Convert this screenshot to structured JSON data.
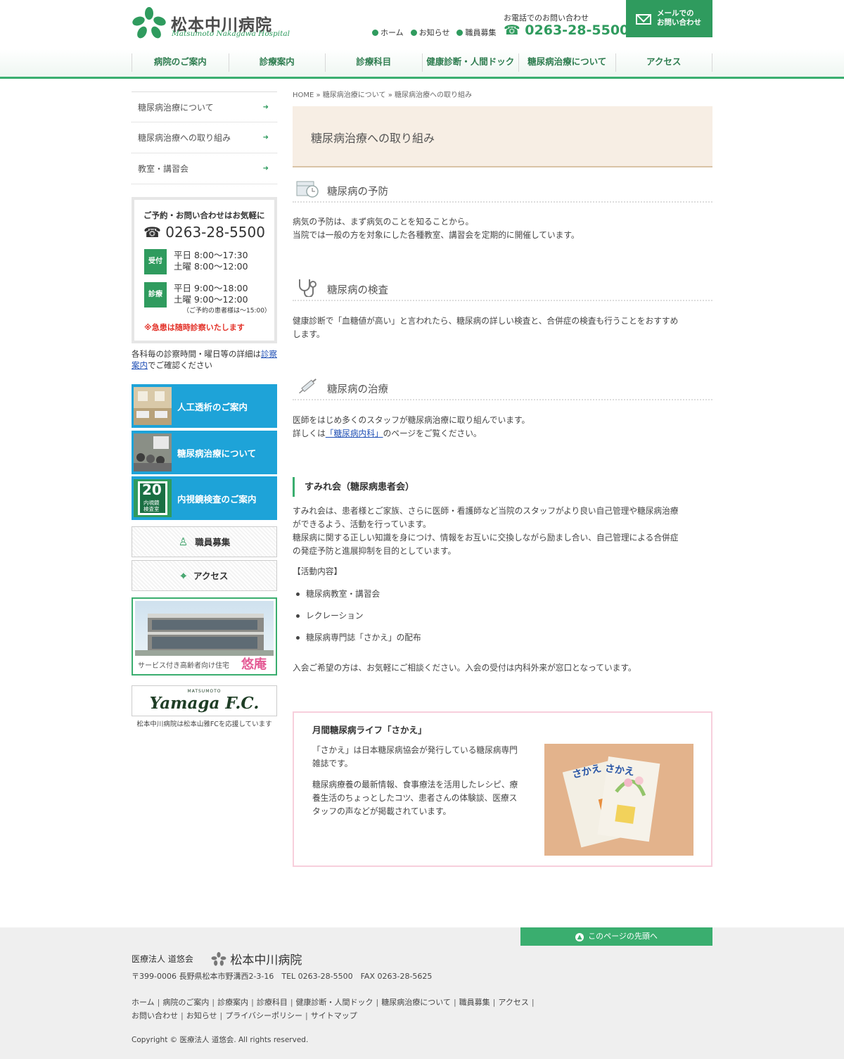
{
  "header": {
    "logo_name": "松本中川病院",
    "logo_en": "Matsumoto Nakagawa Hospital",
    "toplinks": [
      "ホーム",
      "お知らせ",
      "職員募集"
    ],
    "tel_label": "お電話でのお問い合わせ",
    "tel": "0263-28-5500",
    "mail_btn": [
      "メールでの",
      "お問い合わせ"
    ],
    "nav": [
      "病院のご案内",
      "診療案内",
      "診療科目",
      "健康診断・人間ドック",
      "糖尿病治療について",
      "アクセス"
    ]
  },
  "sidebar": {
    "subnav": [
      "糖尿病治療について",
      "糖尿病治療への取り組み",
      "教室・講習会"
    ],
    "info": {
      "heading": "ご予約・お問い合わせはお気軽に",
      "tel": "0263-28-5500",
      "reception_tag": "受付",
      "reception_lines": [
        "平日 8:00～17:30",
        "土曜 8:00～12:00"
      ],
      "clinic_tag": "診療",
      "clinic_lines": [
        "平日 9:00～18:00",
        "土曜 9:00～12:00"
      ],
      "clinic_note": "（ご予約の患者様は～15:00）",
      "emergency": "※急患は随時診察いたします"
    },
    "desc_before": "各科毎の診察時間・曜日等の詳細は",
    "desc_link": "診察案内",
    "desc_after": "でご確認ください",
    "banners": [
      "人工透析のご案内",
      "糖尿病治療について",
      "内視鏡検査のご案内"
    ],
    "endoscopy_sign": [
      "20",
      "内視鏡",
      "検査室"
    ],
    "btn_recruit": "職員募集",
    "btn_access": "アクセス",
    "yuan_caption": "サービス付き高齢者向け住宅",
    "yuan_name": "悠庵",
    "yamaga_small": "MATSUMOTO",
    "yamaga_logo": "Yamaga F.C.",
    "yamaga_caption": "松本中川病院は松本山雅FCを応援しています"
  },
  "main": {
    "breadcrumb": "HOME » 糖尿病治療について » 糖尿病治療への取り組み",
    "page_title": "糖尿病治療への取り組み",
    "sec1_title": "糖尿病の予防",
    "sec1_text": [
      "病気の予防は、まず病気のことを知ることから。",
      "当院では一般の方を対象にした各種教室、講習会を定期的に開催しています。"
    ],
    "sec2_title": "糖尿病の検査",
    "sec2_text": [
      "健康診断で「血糖値が高い」と言われたら、糖尿病の詳しい検査と、合併症の検査も行うことをおすすめ",
      "します。"
    ],
    "sec3_title": "糖尿病の治療",
    "sec3_text": "医師をはじめ多くのスタッフが糖尿病治療に取り組んでいます。",
    "sec3_link_before": "詳しくは",
    "sec3_link": "「糖尿病内科」",
    "sec3_link_after": "のページをご覧ください。",
    "sumire_title": "すみれ会（糖尿病患者会）",
    "sumire_text": [
      "すみれ会は、患者様とご家族、さらに医師・看護師など当院のスタッフがより良い自己管理や糖尿病治療",
      "ができるよう、活動を行っています。",
      "糖尿病に関する正しい知識を身につけ、情報をお互いに交換しながら励まし合い、自己管理による合併症",
      "の発症予防と進展抑制を目的としています。"
    ],
    "activity_label": "【活動内容】",
    "activities": [
      "糖尿病教室・講習会",
      "レクレーション",
      "糖尿病専門誌「さかえ」の配布"
    ],
    "join_text": "入会ご希望の方は、お気軽にご相談ください。入会の受付は内科外来が窓口となっています。",
    "sakae_title": "月間糖尿病ライフ「さかえ」",
    "sakae_p1": [
      "「さかえ」は日本糖尿病協会が発行している糖尿病専門",
      "雑誌です。"
    ],
    "sakae_p2": [
      "糖尿病療養の最新情報、食事療法を活用したレシピ、療",
      "養生活のちょっとしたコツ、患者さんの体験談、医療ス",
      "タッフの声などが掲載されています。"
    ],
    "sakae_cover": "さかえ"
  },
  "footer": {
    "totop": "このページの先頭へ",
    "corp": "医療法人 道悠会",
    "name": "松本中川病院",
    "address": "〒399-0006 長野県松本市野溝西2-3-16　TEL 0263-28-5500　FAX 0263-28-5625",
    "links_row1": [
      "ホーム",
      "病院のご案内",
      "診療案内",
      "診療科目",
      "健康診断・人間ドック",
      "糖尿病治療について",
      "職員募集",
      "アクセス"
    ],
    "links_row2": [
      "お問い合わせ",
      "お知らせ",
      "プライバシーポリシー",
      "サイトマップ"
    ],
    "copyright": "Copyright © 医療法人 道悠会. All rights reserved."
  },
  "colors": {
    "brand_green": "#2f9b5e",
    "banner_blue": "#1ea3d8",
    "title_bg": "#f7eee4",
    "alert_red": "#e3332a",
    "sakae_border": "#f7cfdc"
  }
}
